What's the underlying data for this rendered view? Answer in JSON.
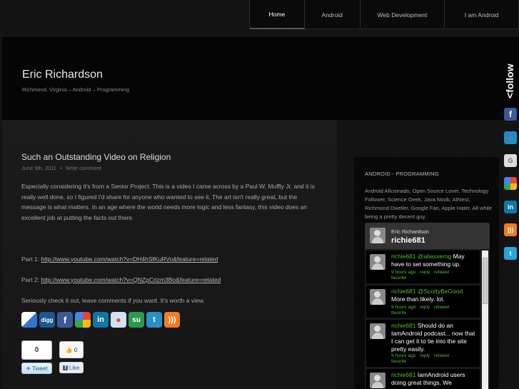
{
  "nav": {
    "items": [
      "Home",
      "Android",
      "Web Development",
      "I am Android"
    ]
  },
  "header": {
    "title": "Eric Richardson",
    "tagline": "Richmond, Virginia – Android – Programming"
  },
  "post": {
    "title": "Such an Outstanding Video on Religion",
    "date": "June 9th, 2011",
    "comment_link": "Write comment",
    "paragraph1": "Especially considering it's from a Senior Project. This is a video I came across by a Paul W. Muffly Jr. and it is really well done, so I figured I'd share for anyone who wanted to see it. The art isn't really great, but the message is what matters. In an age where the world needs more logic and less fantasy, this video does an excellent job at putting the facts out there.",
    "part1_label": "Part 1: ",
    "part1_url": "http://www.youtube.com/watch?v=DH4hSfKuRVo&feature=related",
    "part2_label": "Part 2: ",
    "part2_url": "http://www.youtube.com/watch?v=QNZpCrizm3Bo&feature=related",
    "closing": "Seriously check it out, leave comments if you want. It's worth a view."
  },
  "share": {
    "icons": [
      "delicious-icon",
      "digg-icon",
      "facebook-icon",
      "google-icon",
      "linkedin-icon",
      "reddit-icon",
      "stumbleupon-icon",
      "twitter-icon",
      "rss-icon"
    ],
    "digg_label": "digg",
    "tweet_count": "0",
    "tweet_label": "Tweet",
    "like_count": "0",
    "like_label": "Like"
  },
  "sidebar": {
    "heading": "ANDROID - PROGRAMMING",
    "description": "Android Aficionado, Open Source Lover, Technology Follower, Science Geek, Java Noob, Athiest, Richmond Dweller, Google Fan, Apple Hater. All while being a pretty decent guy."
  },
  "twitter": {
    "name": "Eric Richardson",
    "username": "richie681",
    "tweets": [
      {
        "user": "richie681",
        "mention": "@aliasxerog",
        "text": "May have to set something up.",
        "time": "9 hours ago",
        "reply": "reply",
        "retweet": "retweet",
        "favorite": "favorite"
      },
      {
        "user": "richie681",
        "mention": "@ScottyBeGood",
        "text": "More than likely. lol.",
        "time": "9 hours ago",
        "reply": "reply",
        "retweet": "retweet",
        "favorite": "favorite"
      },
      {
        "user": "richie681",
        "mention": "",
        "text": "Should do an IamAndroid podcast... now that I can get it to tie into the site pretty easily.",
        "time": "9 hours ago",
        "reply": "reply",
        "retweet": "retweet",
        "favorite": "favorite"
      },
      {
        "user": "richie681",
        "mention": "",
        "text": "IamAndroid users doing great things. We",
        "time": "",
        "reply": "",
        "retweet": "",
        "favorite": ""
      }
    ]
  },
  "follow": {
    "label": "follow",
    "icons": [
      "facebook-icon",
      "foursquare-icon",
      "google-icon",
      "google-reader-icon",
      "linkedin-icon",
      "rss-icon",
      "twitter-icon"
    ]
  }
}
